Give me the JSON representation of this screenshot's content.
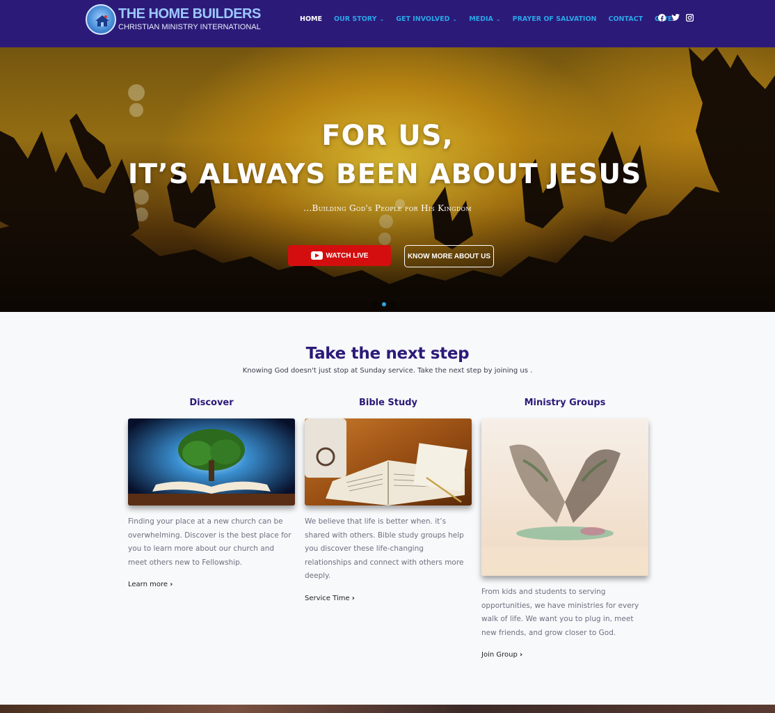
{
  "brand": {
    "title": "THE HOME BUILDERS",
    "subtitle": "CHRISTIAN MINISTRY INTERNATIONAL"
  },
  "nav": {
    "items": [
      {
        "label": "HOME",
        "active": true,
        "dropdown": false
      },
      {
        "label": "OUR STORY",
        "active": false,
        "dropdown": true
      },
      {
        "label": "GET INVOLVED",
        "active": false,
        "dropdown": true
      },
      {
        "label": "MEDIA",
        "active": false,
        "dropdown": true
      },
      {
        "label": "PRAYER OF SALVATION",
        "active": false,
        "dropdown": false
      },
      {
        "label": "CONTACT",
        "active": false,
        "dropdown": false
      },
      {
        "label": "GIVE",
        "active": false,
        "dropdown": false
      }
    ],
    "social": [
      "facebook-icon",
      "twitter-icon",
      "instagram-icon"
    ]
  },
  "hero": {
    "line1": "FOR US,",
    "line2": "IT’S ALWAYS BEEN ABOUT JESUS",
    "tagline": "...Building God's People for His Kingdom",
    "watch_label": "WATCH LIVE",
    "know_label": "KNOW MORE ABOUT US",
    "slides": 3,
    "active_slide": 2
  },
  "next_step": {
    "title": "Take the next step",
    "subtitle": "Knowing God doesn't just stop at Sunday service. Take the next step by joining us ."
  },
  "cards": [
    {
      "title": "Discover",
      "text": "Finding your place at a new church can be overwhelming. Discover is the best place for you to learn more about our church and meet others new to Fellowship.",
      "link": "Learn more"
    },
    {
      "title": "Bible Study",
      "text": "We believe that life is better when. it’s shared with others. Bible study groups help you discover these life-changing relationships and connect with others more deeply.",
      "link": "Service Time"
    },
    {
      "title": "Ministry Groups",
      "text": "From kids and students to serving opportunities, we have ministries for every walk of life. We want you to plug in, meet new friends, and grow closer to God.",
      "link": "Join Group"
    }
  ],
  "colors": {
    "header_bg": "#2c1a78",
    "nav_link": "#2aa6e8",
    "accent_red": "#d40e0e",
    "heading": "#2c1a78"
  }
}
